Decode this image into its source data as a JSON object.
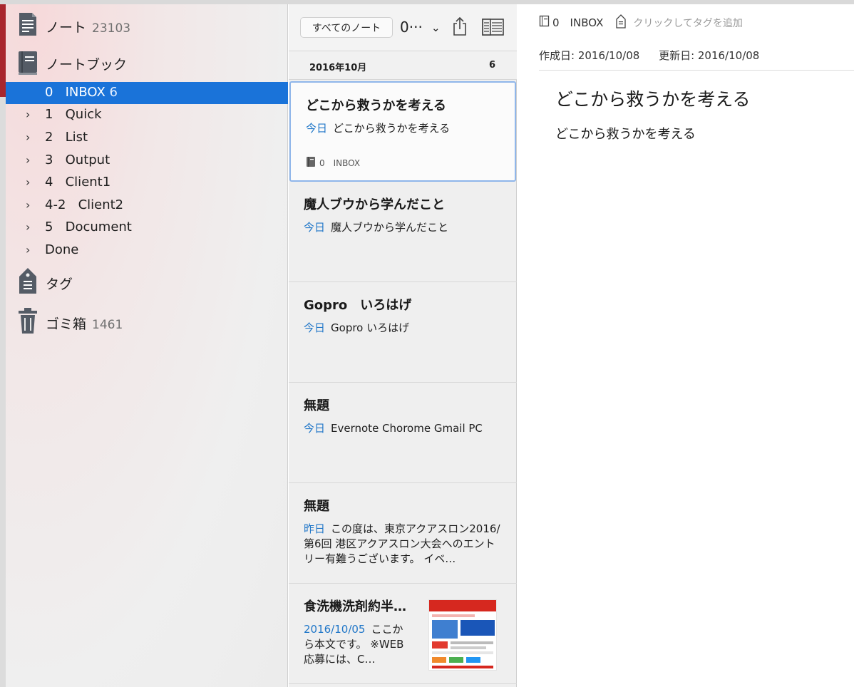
{
  "sidebar": {
    "notes": {
      "label": "ノート",
      "count": "23103"
    },
    "notebooks": {
      "label": "ノートブック"
    },
    "items": [
      {
        "label": "0   INBOX",
        "count": "6",
        "active": true,
        "chevron": ""
      },
      {
        "label": "1   Quick",
        "chevron": "›"
      },
      {
        "label": "2   List",
        "chevron": "›"
      },
      {
        "label": "3   Output",
        "chevron": "›"
      },
      {
        "label": "4   Client1",
        "chevron": "›"
      },
      {
        "label": "4-2   Client2",
        "chevron": "›"
      },
      {
        "label": "5   Document",
        "chevron": "›"
      },
      {
        "label": "Done",
        "chevron": "›"
      }
    ],
    "tags": {
      "label": "タグ"
    },
    "trash": {
      "label": "ゴミ箱",
      "count": "1461"
    }
  },
  "list": {
    "filter_button": "すべてのノート",
    "sort_value": "0···",
    "month": "2016年10月",
    "month_count": "6",
    "notes": [
      {
        "title": "どこから救うかを考える",
        "date": "今日",
        "snippet": "どこから救うかを考える",
        "notebook_count": "0",
        "notebook": "INBOX"
      },
      {
        "title": "魔人ブウから学んだこと",
        "date": "今日",
        "snippet": "魔人ブウから学んだこと"
      },
      {
        "title": "Gopro　いろはげ",
        "date": "今日",
        "snippet": "Gopro いろはげ"
      },
      {
        "title": "無題",
        "date": "今日",
        "snippet": "Evernote Chorome Gmail PC"
      },
      {
        "title": "無題",
        "date": "昨日",
        "snippet": "この度は、東京アクアスロン2016/第6回 港区アクアスロン大会へのエントリー有難うございます。 イベ…"
      },
      {
        "title": "食洗機洗剤約半…",
        "date": "2016/10/05",
        "snippet": "ここから本文です。 ※WEB 応募には、C…"
      }
    ]
  },
  "editor": {
    "notebook_count": "0",
    "notebook": "INBOX",
    "tag_placeholder": "クリックしてタグを追加",
    "created": "作成日: 2016/10/08",
    "updated": "更新日: 2016/10/08",
    "title": "どこから救うかを考える",
    "body": "どこから救うかを考える"
  },
  "colors": {
    "accent": "#1a73d9",
    "date_blue": "#1f76c8",
    "brand_red": "#a8262d"
  },
  "icons": [
    "note-icon",
    "notebook-icon",
    "tag-icon",
    "trash-icon",
    "share-icon",
    "view-toggle-icon",
    "chevron-down-icon",
    "chevron-right-icon"
  ]
}
